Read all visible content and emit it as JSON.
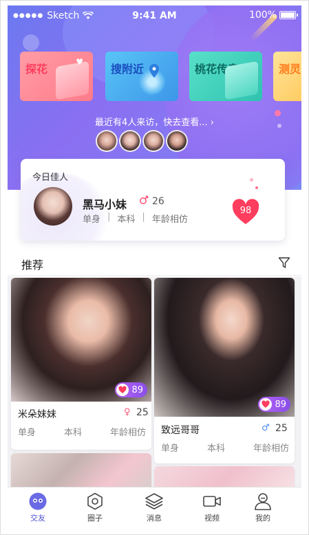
{
  "status_bar": {
    "carrier": "Sketch",
    "time": "9:41 AM",
    "battery": "100%"
  },
  "features": [
    {
      "label": "探花"
    },
    {
      "label": "搜附近"
    },
    {
      "label": "桃花传音"
    },
    {
      "label": "测灵"
    }
  ],
  "visitors": {
    "text": "最近有4人来访，快去查看...",
    "chevron": "›",
    "count": 4
  },
  "today": {
    "title": "今日佳人",
    "name": "黑马小妹",
    "gender_icon": "female-icon",
    "age": "26",
    "tags": [
      "单身",
      "本科",
      "年龄相仿"
    ],
    "score": "98"
  },
  "recommend": {
    "title": "推荐",
    "filter_icon": "filter-icon"
  },
  "posts": [
    {
      "name": "米朵妹妹",
      "gender": "♀",
      "age": "25",
      "likes": "89",
      "tags": [
        "单身",
        "本科",
        "年龄相仿"
      ]
    },
    {
      "name": "致远哥哥",
      "gender": "♂",
      "age": "25",
      "likes": "89",
      "tags": [
        "单身",
        "本科",
        "年龄相仿"
      ]
    }
  ],
  "tabbar": [
    {
      "label": "交友",
      "icon": "chat-face-icon",
      "active": true
    },
    {
      "label": "圈子",
      "icon": "hexagon-icon",
      "active": false
    },
    {
      "label": "消息",
      "icon": "layers-icon",
      "active": false
    },
    {
      "label": "视频",
      "icon": "video-icon",
      "active": false
    },
    {
      "label": "我的",
      "icon": "profile-icon",
      "active": false
    }
  ],
  "colors": {
    "header_gradient_start": "#6b79f0",
    "header_gradient_end": "#8b6ff2",
    "heart_red": "#ff3d5e",
    "likes_purple": "#9a55ee",
    "tab_active": "#4d4fcf"
  }
}
